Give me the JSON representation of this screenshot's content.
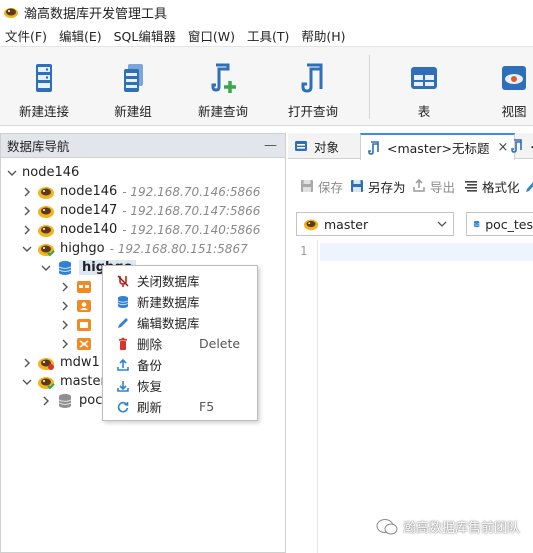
{
  "app": {
    "title": "瀚高数据库开发管理工具"
  },
  "menu": [
    "文件(F)",
    "编辑(E)",
    "SQL编辑器",
    "窗口(W)",
    "工具(T)",
    "帮助(H)"
  ],
  "toolbar": {
    "new_connection": "新建连接",
    "new_group": "新建组",
    "new_query": "新建查询",
    "open_query": "打开查询",
    "table": "表",
    "view": "视图"
  },
  "navigator": {
    "title": "数据库导航",
    "minimize": "—",
    "root": "node146",
    "nodes": [
      {
        "name": "node146",
        "addr": "- 192.168.70.146:5866"
      },
      {
        "name": "node147",
        "addr": "- 192.168.70.147:5866"
      },
      {
        "name": "node140",
        "addr": "- 192.168.70.140:5866"
      },
      {
        "name": "highgo",
        "addr": "- 192.168.80.151:5867"
      }
    ],
    "selected_db": "highgo",
    "mdw_node": "mdw1",
    "master_node": "master",
    "poc_db": "poc"
  },
  "context_menu": {
    "close_db": "关闭数据库",
    "new_db": "新建数据库",
    "edit_db": "编辑数据库",
    "delete": "删除",
    "delete_key": "Delete",
    "backup": "备份",
    "restore": "恢复",
    "refresh": "刷新",
    "refresh_key": "F5"
  },
  "tabs": {
    "objects": "对象",
    "query_tab": "<master>无标题",
    "close": "×",
    "next_tab_fragment": "<"
  },
  "editor_toolbar": {
    "save": "保存",
    "save_as": "另存为",
    "export": "导出",
    "format": "格式化"
  },
  "connection_select": "master",
  "database_select": "poc_tes",
  "editor": {
    "line_number": "1"
  },
  "watermark": "瀚高数据库售前团队",
  "colors": {
    "accent": "#3a8ee6",
    "nav_header": "#e2e6ec",
    "selection": "#dde6f3",
    "delete_red": "#d9342b"
  }
}
